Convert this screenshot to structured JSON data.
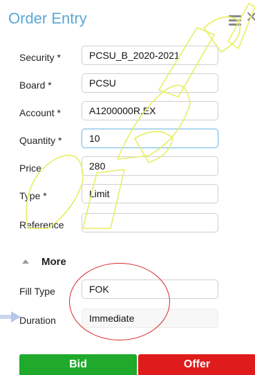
{
  "panel": {
    "title": "Order Entry"
  },
  "fields": [
    {
      "key": "security",
      "label": "Security *",
      "value": "PCSU_B_2020-2021"
    },
    {
      "key": "board",
      "label": "Board *",
      "value": "PCSU"
    },
    {
      "key": "account",
      "label": "Account *",
      "value": "A1200000R.EX"
    },
    {
      "key": "quantity",
      "label": "Quantity *",
      "value": "10"
    },
    {
      "key": "price",
      "label": "Price",
      "value": "280"
    },
    {
      "key": "type",
      "label": "Type *",
      "value": "Limit"
    },
    {
      "key": "reference",
      "label": "Reference",
      "value": ""
    }
  ],
  "more": {
    "label": "More"
  },
  "advanced": [
    {
      "key": "fill_type",
      "label": "Fill Type",
      "value": "FOK"
    },
    {
      "key": "duration",
      "label": "Duration",
      "value": "Immediate"
    }
  ],
  "buttons": {
    "bid": "Bid",
    "offer": "Offer"
  },
  "colors": {
    "title": "#5aa8d6",
    "bid": "#1faa2b",
    "offer": "#e01b1b",
    "annotation": "#d62525"
  },
  "icons": {
    "menu": "hamburger-menu-icon",
    "close": "close-icon",
    "expand": "chevron-up-icon"
  }
}
